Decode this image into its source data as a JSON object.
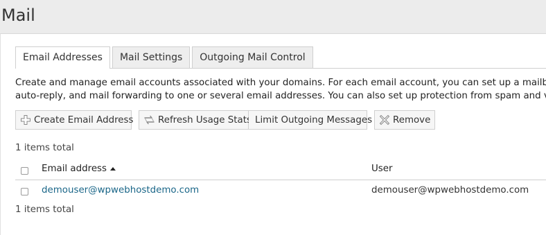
{
  "page": {
    "title": "Mail"
  },
  "tabs": [
    {
      "label": "Email Addresses",
      "active": true
    },
    {
      "label": "Mail Settings",
      "active": false
    },
    {
      "label": "Outgoing Mail Control",
      "active": false
    }
  ],
  "description": {
    "line1": "Create and manage email accounts associated with your domains. For each email account, you can set up a mailbox, a number of aliases,",
    "line2": "auto-reply, and mail forwarding to one or several email addresses. You can also set up protection from spam and viruses, if these services"
  },
  "toolbar": {
    "create_label": "Create Email Address",
    "create_icon": "plus-icon",
    "refresh_label": "Refresh Usage Stats",
    "refresh_icon": "refresh-icon",
    "limit_label": "Limit Outgoing Messages",
    "remove_label": "Remove",
    "remove_icon": "remove-x-icon"
  },
  "list": {
    "items_total_top": "1 items total",
    "items_total_bottom": "1 items total",
    "columns": {
      "email": "Email address",
      "user": "User"
    },
    "sort": {
      "column": "email",
      "direction": "ascending"
    },
    "rows": [
      {
        "email": "demouser@wpwebhostdemo.com",
        "user": "demouser@wpwebhostdemo.com"
      }
    ]
  },
  "colors": {
    "link": "#1a6688",
    "panel_bg": "#ffffff",
    "header_bg": "#ececec",
    "button_bg": "#f6f6f6",
    "border": "#cfcfcf"
  }
}
